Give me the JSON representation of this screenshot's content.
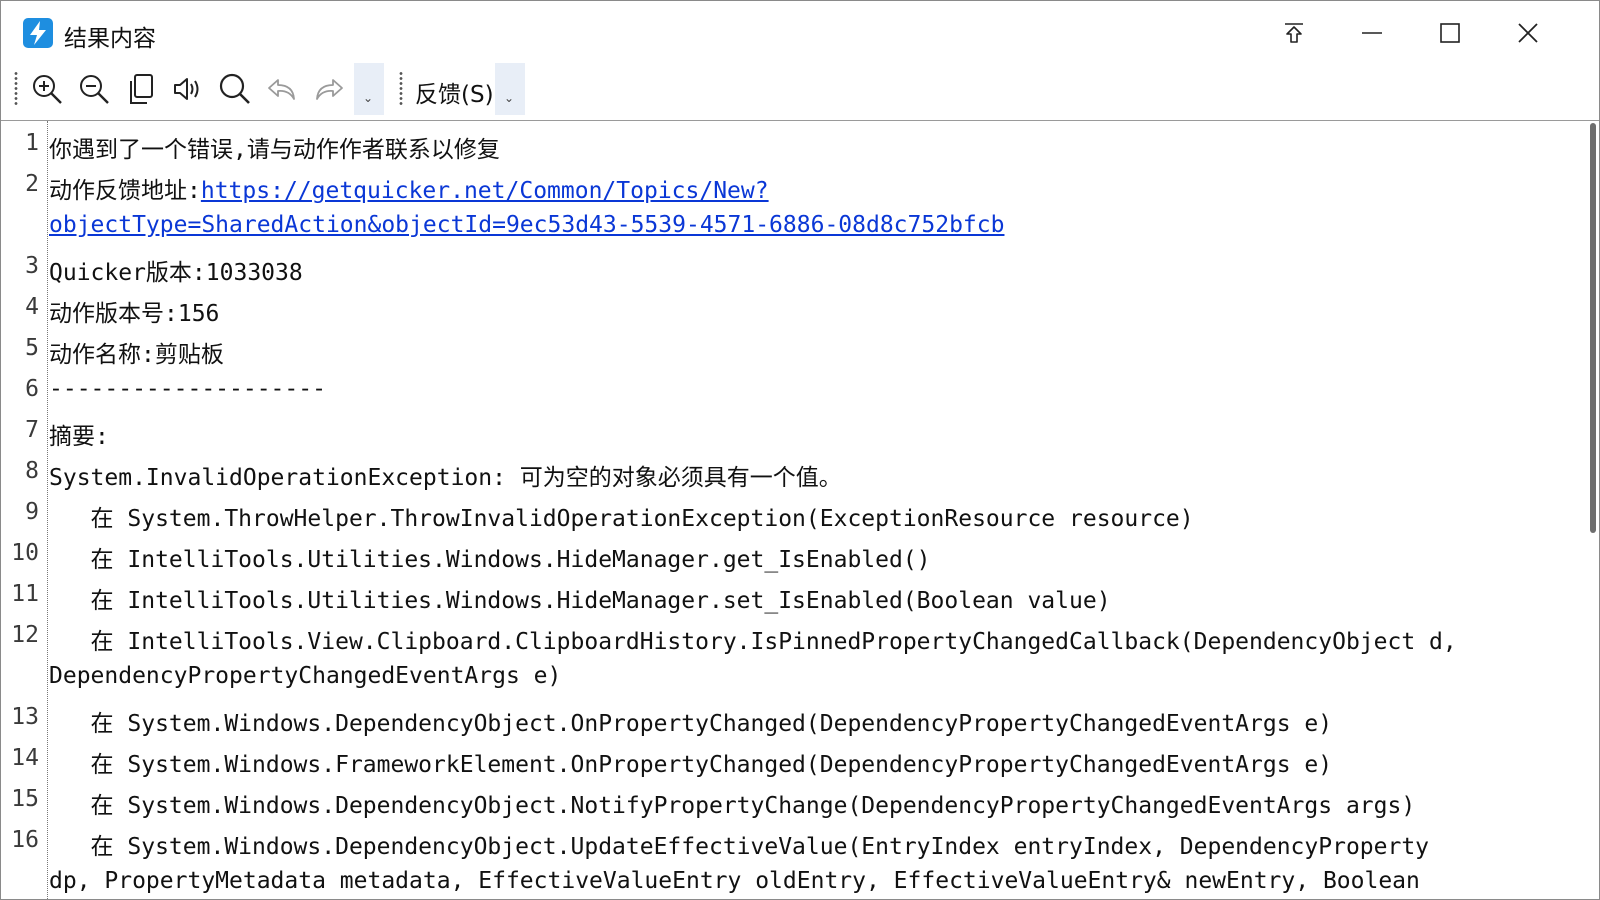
{
  "window": {
    "title": "结果内容"
  },
  "toolbar": {
    "feedback_label": "反馈(S)",
    "overflow_glyph": "⌄",
    "buttons": [
      "zoom-in-icon",
      "zoom-out-icon",
      "copy-icon",
      "speaker-icon",
      "search-icon",
      "undo-icon",
      "redo-icon"
    ]
  },
  "editor": {
    "lines": [
      {
        "n": "1",
        "text": "你遇到了一个错误,请与动作作者联系以修复"
      },
      {
        "n": "2",
        "text": "动作反馈地址:",
        "link": "https://getquicker.net/Common/Topics/New?"
      },
      {
        "n": "",
        "text": "",
        "link": "objectType=SharedAction&objectId=9ec53d43-5539-4571-6886-08d8c752bfcb"
      },
      {
        "n": "3",
        "text": "Quicker版本:1033038"
      },
      {
        "n": "4",
        "text": "动作版本号:156"
      },
      {
        "n": "5",
        "text": "动作名称:剪贴板"
      },
      {
        "n": "6",
        "text": "--------------------"
      },
      {
        "n": "7",
        "text": "摘要:"
      },
      {
        "n": "8",
        "text": "System.InvalidOperationException: 可为空的对象必须具有一个值。"
      },
      {
        "n": "9",
        "text": "   在 System.ThrowHelper.ThrowInvalidOperationException(ExceptionResource resource)"
      },
      {
        "n": "10",
        "text": "   在 IntelliTools.Utilities.Windows.HideManager.get_IsEnabled()"
      },
      {
        "n": "11",
        "text": "   在 IntelliTools.Utilities.Windows.HideManager.set_IsEnabled(Boolean value)"
      },
      {
        "n": "12",
        "text": "   在 IntelliTools.View.Clipboard.ClipboardHistory.IsPinnedPropertyChangedCallback(DependencyObject d,"
      },
      {
        "n": "",
        "text": "DependencyPropertyChangedEventArgs e)"
      },
      {
        "n": "13",
        "text": "   在 System.Windows.DependencyObject.OnPropertyChanged(DependencyPropertyChangedEventArgs e)"
      },
      {
        "n": "14",
        "text": "   在 System.Windows.FrameworkElement.OnPropertyChanged(DependencyPropertyChangedEventArgs e)"
      },
      {
        "n": "15",
        "text": "   在 System.Windows.DependencyObject.NotifyPropertyChange(DependencyPropertyChangedEventArgs args)"
      },
      {
        "n": "16",
        "text": "   在 System.Windows.DependencyObject.UpdateEffectiveValue(EntryIndex entryIndex, DependencyProperty"
      },
      {
        "n": "",
        "text": "dp, PropertyMetadata metadata, EffectiveValueEntry oldEntry, EffectiveValueEntry& newEntry, Boolean"
      }
    ]
  }
}
